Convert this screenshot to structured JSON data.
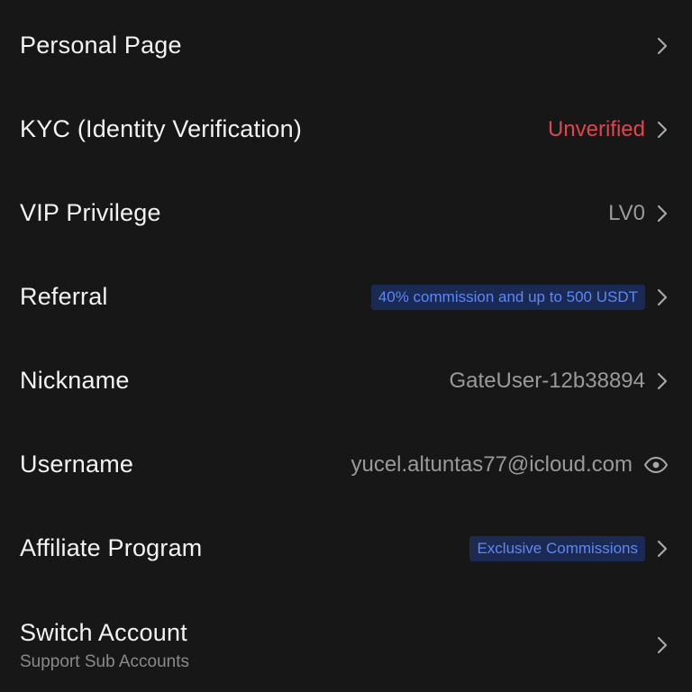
{
  "rows": [
    {
      "label": "Personal Page"
    },
    {
      "label": "KYC (Identity Verification)",
      "value": "Unverified"
    },
    {
      "label": "VIP Privilege",
      "value": "LV0"
    },
    {
      "label": "Referral",
      "badge": "40% commission and up to 500 USDT"
    },
    {
      "label": "Nickname",
      "value": "GateUser-12b38894"
    },
    {
      "label": "Username",
      "value": "yucel.altuntas77@icloud.com",
      "icon": "eye-icon"
    },
    {
      "label": "Affiliate Program",
      "badge": "Exclusive Commissions"
    },
    {
      "label": "Switch Account",
      "sublabel": "Support Sub Accounts"
    }
  ],
  "colors": {
    "background": "#171717",
    "warning": "#e0454e",
    "badge_bg": "#1b2a52",
    "badge_text": "#5d87f5",
    "muted": "#9a9a9a"
  }
}
